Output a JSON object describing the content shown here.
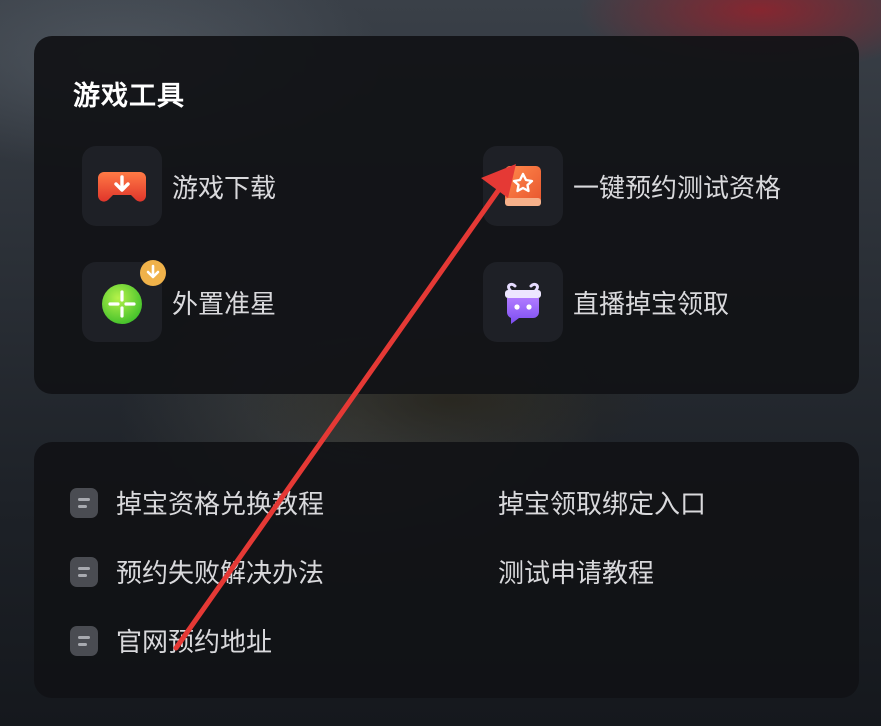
{
  "game_tools": {
    "title": "游戏工具",
    "items": [
      {
        "label": "游戏下载",
        "icon": "gamepad-download-icon"
      },
      {
        "label": "一键预约测试资格",
        "icon": "reservation-book-icon"
      },
      {
        "label": "外置准星",
        "icon": "crosshair-icon",
        "badge_icon": "download-badge-icon"
      },
      {
        "label": "直播掉宝领取",
        "icon": "live-gift-icon"
      }
    ]
  },
  "guides": {
    "items": [
      {
        "label": "掉宝资格兑换教程",
        "icon": "document-icon"
      },
      {
        "label": "掉宝领取绑定入口"
      },
      {
        "label": "预约失败解决办法",
        "icon": "document-icon"
      },
      {
        "label": "测试申请教程"
      },
      {
        "label": "官网预约地址",
        "icon": "document-icon"
      }
    ]
  },
  "colors": {
    "panel_bg": "#111216",
    "text": "#d9d9dc",
    "title": "#ffffff",
    "annotation_arrow": "#e53935"
  }
}
